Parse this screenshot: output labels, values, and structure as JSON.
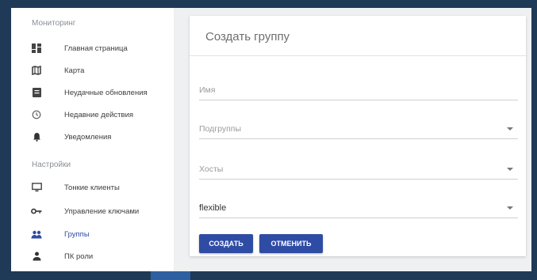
{
  "sidebar": {
    "monitoring_title": "Мониторинг",
    "settings_title": "Настройки",
    "monitoring_items": [
      {
        "label": "Главная страница",
        "icon": "dashboard-icon"
      },
      {
        "label": "Карта",
        "icon": "map-icon"
      },
      {
        "label": "Неудачные обновления",
        "icon": "failed-updates-icon"
      },
      {
        "label": "Недавние действия",
        "icon": "history-icon"
      },
      {
        "label": "Уведомления",
        "icon": "bell-icon"
      }
    ],
    "settings_items": [
      {
        "label": "Тонкие клиенты",
        "icon": "monitor-icon"
      },
      {
        "label": "Управление ключами",
        "icon": "key-icon"
      },
      {
        "label": "Группы",
        "icon": "group-icon"
      },
      {
        "label": "ПК роли",
        "icon": "person-icon"
      }
    ],
    "active_item": "Группы"
  },
  "form": {
    "title": "Создать группу",
    "name_placeholder": "Имя",
    "subgroups_placeholder": "Подгруппы",
    "hosts_placeholder": "Хосты",
    "profile_value": "flexible",
    "create_button": "СОЗДАТЬ",
    "cancel_button": "ОТМЕНИТЬ"
  },
  "colors": {
    "accent": "#2f4ca5",
    "background": "#1f3a57"
  }
}
